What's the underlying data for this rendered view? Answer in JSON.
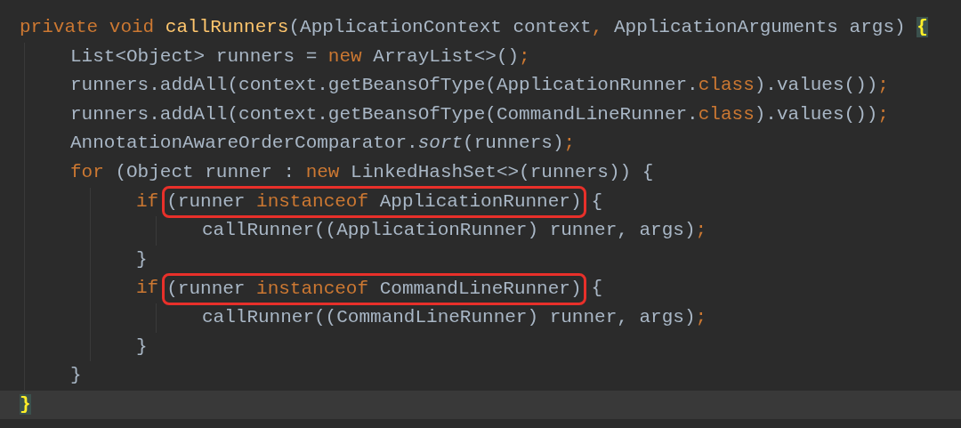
{
  "editor": {
    "lines": [
      {
        "segments": [
          {
            "kind": "text",
            "tokens": [
              {
                "kind": "keyword",
                "text": "private void "
              },
              {
                "kind": "method",
                "text": "callRunners"
              },
              {
                "kind": "plain",
                "text": "(ApplicationContext context"
              },
              {
                "kind": "keyword",
                "text": ","
              },
              {
                "kind": "plain",
                "text": " ApplicationArguments args) "
              },
              {
                "kind": "brace_match",
                "text": "{"
              }
            ]
          }
        ],
        "children": [
          {
            "segments": [
              {
                "kind": "text",
                "tokens": [
                  {
                    "kind": "plain",
                    "text": "List<Object> runners = "
                  },
                  {
                    "kind": "keyword",
                    "text": "new"
                  },
                  {
                    "kind": "plain",
                    "text": " ArrayList<>()"
                  },
                  {
                    "kind": "keyword",
                    "text": ";"
                  }
                ]
              }
            ]
          },
          {
            "segments": [
              {
                "kind": "text",
                "tokens": [
                  {
                    "kind": "plain",
                    "text": "runners.addAll(context.getBeansOfType(ApplicationRunner."
                  },
                  {
                    "kind": "keyword",
                    "text": "class"
                  },
                  {
                    "kind": "plain",
                    "text": ").values())"
                  },
                  {
                    "kind": "keyword",
                    "text": ";"
                  }
                ]
              }
            ]
          },
          {
            "segments": [
              {
                "kind": "text",
                "tokens": [
                  {
                    "kind": "plain",
                    "text": "runners.addAll(context.getBeansOfType(CommandLineRunner."
                  },
                  {
                    "kind": "keyword",
                    "text": "class"
                  },
                  {
                    "kind": "plain",
                    "text": ").values())"
                  },
                  {
                    "kind": "keyword",
                    "text": ";"
                  }
                ]
              }
            ]
          },
          {
            "segments": [
              {
                "kind": "text",
                "tokens": [
                  {
                    "kind": "plain",
                    "text": "AnnotationAwareOrderComparator."
                  },
                  {
                    "kind": "italic",
                    "text": "sort"
                  },
                  {
                    "kind": "plain",
                    "text": "(runners)"
                  },
                  {
                    "kind": "keyword",
                    "text": ";"
                  }
                ]
              }
            ]
          },
          {
            "segments": [
              {
                "kind": "text",
                "tokens": [
                  {
                    "kind": "keyword",
                    "text": "for"
                  },
                  {
                    "kind": "plain",
                    "text": " (Object runner : "
                  },
                  {
                    "kind": "keyword",
                    "text": "new"
                  },
                  {
                    "kind": "plain",
                    "text": " LinkedHashSet<>(runners)) {"
                  }
                ]
              }
            ],
            "children": [
              {
                "segments": [
                  {
                    "kind": "text",
                    "tokens": [
                      {
                        "kind": "keyword",
                        "text": "if"
                      }
                    ]
                  },
                  {
                    "kind": "box",
                    "tokens": [
                      {
                        "kind": "plain",
                        "text": "(runner "
                      },
                      {
                        "kind": "keyword",
                        "text": "instanceof"
                      },
                      {
                        "kind": "plain",
                        "text": " ApplicationRunner)"
                      }
                    ]
                  },
                  {
                    "kind": "text",
                    "tokens": [
                      {
                        "kind": "plain",
                        "text": "{"
                      }
                    ]
                  }
                ],
                "children": [
                  {
                    "segments": [
                      {
                        "kind": "text",
                        "tokens": [
                          {
                            "kind": "plain",
                            "text": "callRunner((ApplicationRunner) runner, args)"
                          },
                          {
                            "kind": "keyword",
                            "text": ";"
                          }
                        ]
                      }
                    ]
                  }
                ]
              },
              {
                "segments": [
                  {
                    "kind": "text",
                    "tokens": [
                      {
                        "kind": "plain",
                        "text": "}"
                      }
                    ]
                  }
                ]
              },
              {
                "segments": [
                  {
                    "kind": "text",
                    "tokens": [
                      {
                        "kind": "keyword",
                        "text": "if"
                      }
                    ]
                  },
                  {
                    "kind": "box",
                    "tokens": [
                      {
                        "kind": "plain",
                        "text": "(runner "
                      },
                      {
                        "kind": "keyword",
                        "text": "instanceof"
                      },
                      {
                        "kind": "plain",
                        "text": " CommandLineRunner)"
                      }
                    ]
                  },
                  {
                    "kind": "text",
                    "tokens": [
                      {
                        "kind": "plain",
                        "text": "{"
                      }
                    ]
                  }
                ],
                "children": [
                  {
                    "segments": [
                      {
                        "kind": "text",
                        "tokens": [
                          {
                            "kind": "plain",
                            "text": "callRunner((CommandLineRunner) runner, args)"
                          },
                          {
                            "kind": "keyword",
                            "text": ";"
                          }
                        ]
                      }
                    ]
                  }
                ]
              },
              {
                "segments": [
                  {
                    "kind": "text",
                    "tokens": [
                      {
                        "kind": "plain",
                        "text": "}"
                      }
                    ]
                  }
                ]
              }
            ]
          },
          {
            "segments": [
              {
                "kind": "text",
                "tokens": [
                  {
                    "kind": "plain",
                    "text": "}"
                  }
                ]
              }
            ]
          }
        ]
      },
      {
        "current": true,
        "segments": [
          {
            "kind": "text",
            "tokens": [
              {
                "kind": "brace_match",
                "text": "}"
              }
            ]
          }
        ]
      }
    ]
  }
}
